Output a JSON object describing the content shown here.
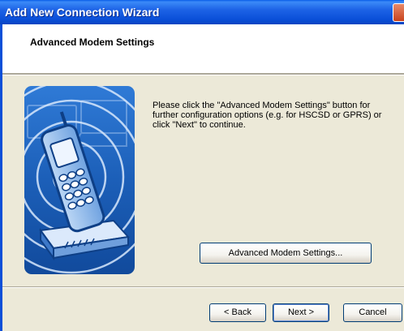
{
  "window": {
    "title": "Add New Connection Wizard"
  },
  "header": {
    "heading": "Advanced Modem Settings"
  },
  "main": {
    "illustration": "mobile-phone-wireless-signal",
    "info_text": "Please click the \"Advanced Modem Settings\" button for further configuration options (e.g. for HSCSD or GPRS) or click \"Next\" to continue.",
    "advanced_button_label": "Advanced Modem Settings..."
  },
  "footer": {
    "back_label": "< Back",
    "next_label": "Next >",
    "cancel_label": "Cancel"
  },
  "colors": {
    "titlebar": "#0a4fd8",
    "dialog_bg": "#ece9d8",
    "art_blue": "#1c5fb8"
  }
}
